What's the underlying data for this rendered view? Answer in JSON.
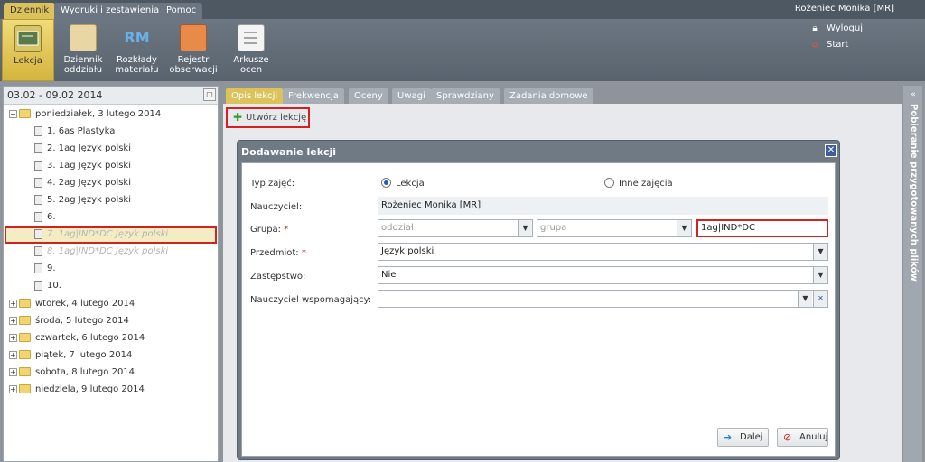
{
  "menu": {
    "tabs": [
      "Dziennik",
      "Wydruki i zestawienia",
      "Pomoc"
    ],
    "user": "Rożeniec Monika [MR]"
  },
  "toolbar": {
    "lekcja": "Lekcja",
    "dziennik": [
      "Dziennik",
      "oddziału"
    ],
    "rozklady": [
      "Rozkłady",
      "materiału"
    ],
    "rejestr": [
      "Rejestr",
      "obserwacji"
    ],
    "arkusze": [
      "Arkusze",
      "ocen"
    ],
    "rm_text": "RM"
  },
  "links": {
    "logout": "Wyloguj",
    "start": "Start"
  },
  "left": {
    "date_range": "03.02 - 09.02 2014",
    "monday": "poniedziałek, 3 lutego 2014",
    "lessons": [
      "1. 6as Plastyka",
      "2. 1ag Język polski",
      "3. 1ag Język polski",
      "4. 2ag Język polski",
      "5. 2ag Język polski",
      "6.",
      "7. 1ag|IND*DC Język polski",
      "8. 1ag|IND*DC Język polski",
      "9.",
      "10."
    ],
    "days": [
      "wtorek, 4 lutego 2014",
      "środa, 5 lutego 2014",
      "czwartek, 6 lutego 2014",
      "piątek, 7 lutego 2014",
      "sobota, 8 lutego 2014",
      "niedziela, 9 lutego 2014"
    ]
  },
  "tabs": [
    "Opis lekcji",
    "Frekwencja",
    "Oceny",
    "Uwagi",
    "Sprawdziany",
    "Zadania domowe"
  ],
  "create_label": "Utwórz lekcję",
  "dialog": {
    "title": "Dodawanie lekcji",
    "typ_label": "Typ zajęć:",
    "opt_lekcja": "Lekcja",
    "opt_inne": "Inne zajęcia",
    "nauczyciel_label": "Nauczyciel:",
    "nauczyciel_value": "Rożeniec Monika [MR]",
    "grupa_label": "Grupa:",
    "oddzial_placeholder": "oddział",
    "grupa_placeholder": "grupa",
    "grupa_value": "1ag|IND*DC",
    "przedmiot_label": "Przedmiot:",
    "przedmiot_value": "Język polski",
    "zastepstwo_label": "Zastępstwo:",
    "zastepstwo_value": "Nie",
    "wspom_label": "Nauczyciel wspomagający:",
    "wspom_value": "",
    "next": "Dalej",
    "cancel": "Anuluj",
    "req_mark": "*"
  },
  "side_panel": "Pobieranie przygotowanych plików",
  "colors": {
    "accent": "#dcc25a",
    "highlight": "#d32020",
    "header": "#5f6a75"
  }
}
